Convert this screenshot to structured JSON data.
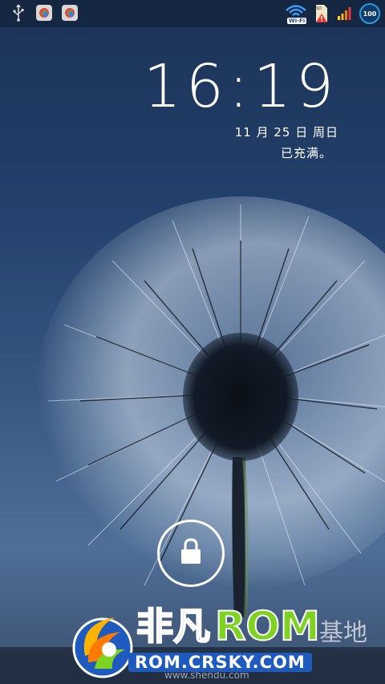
{
  "statusbar": {
    "left_icons": [
      "usb-icon",
      "app-notification-icon",
      "app-notification-icon"
    ],
    "wifi_label": "Wi-Fi",
    "sd_label": "SD",
    "battery_level": "100",
    "icons": [
      "wifi-icon",
      "sd-card-warning-icon",
      "signal-icon",
      "battery-icon"
    ]
  },
  "lockscreen": {
    "time": "16:19",
    "date": "11 月 25 日 周日",
    "charge_status": "已充满。",
    "unlock_icon": "lock-icon"
  },
  "watermark": {
    "brand_cn": "非凡",
    "brand_en": "ROM",
    "faint_text": "基地",
    "url": "ROM.CRSKY.COM",
    "footer_url": "www.shendu.com"
  },
  "colors": {
    "background_top": "#1c3356",
    "background_bottom": "#4f6f98",
    "brand_blue": "#1a4aa8",
    "brand_green": "#7ed321"
  }
}
